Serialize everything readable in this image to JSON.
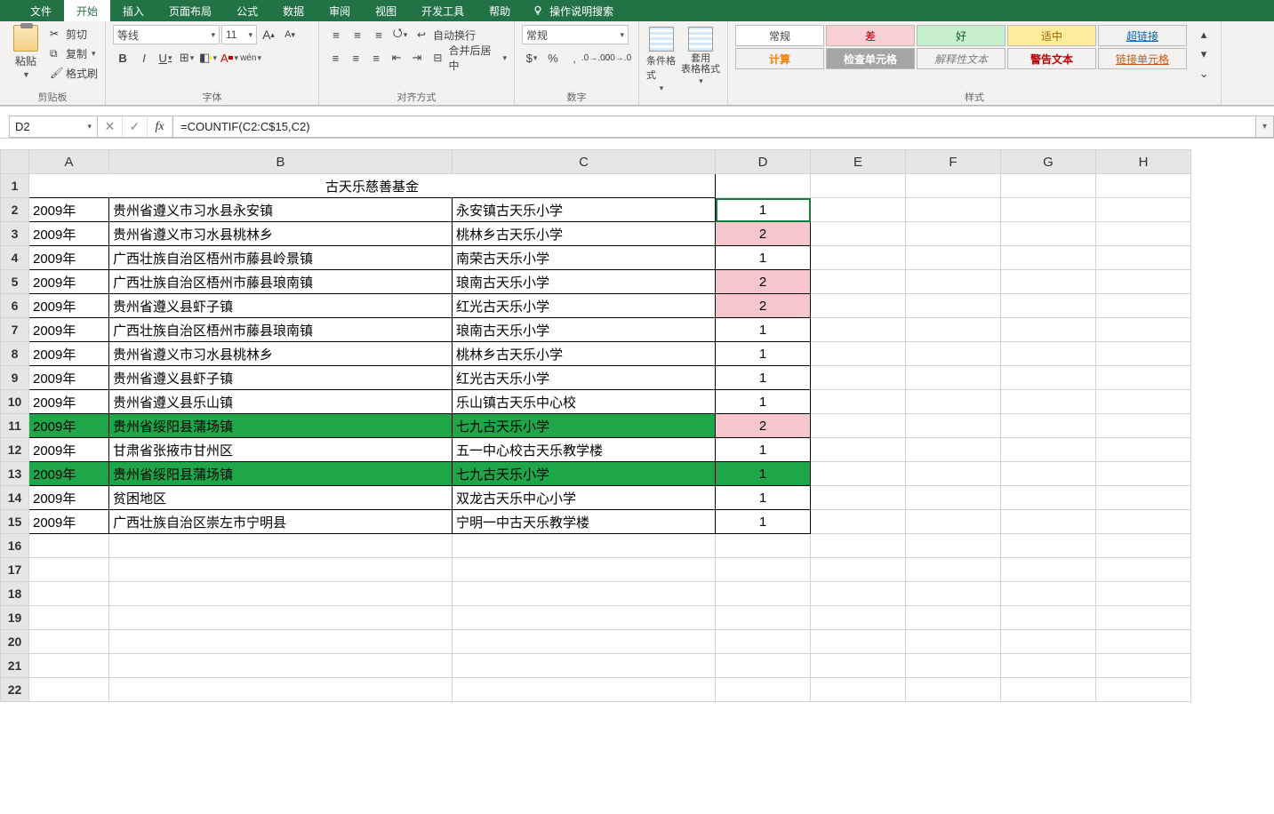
{
  "ribbon_tabs": [
    "文件",
    "开始",
    "插入",
    "页面布局",
    "公式",
    "数据",
    "审阅",
    "视图",
    "开发工具",
    "帮助"
  ],
  "ribbon_tabs_active_index": 1,
  "search_hint": "操作说明搜索",
  "clipboard": {
    "paste": "粘贴",
    "cut": "剪切",
    "copy": "复制",
    "format_painter": "格式刷",
    "group": "剪贴板"
  },
  "font": {
    "name": "等线",
    "size": "11",
    "group": "字体",
    "increase": "A",
    "decrease": "A"
  },
  "alignment": {
    "wrap": "自动换行",
    "merge": "合并后居中",
    "group": "对齐方式"
  },
  "number": {
    "format": "常规",
    "group": "数字"
  },
  "cond": {
    "cond": "条件格式",
    "table": "套用\n表格格式"
  },
  "style_cells": {
    "changgui": "常规",
    "cha": "差",
    "hao": "好",
    "shizhong": "适中",
    "jisuan": "计算",
    "jiancha": "检查单元格",
    "jieshi": "解释性文本",
    "jinggao": "警告文本",
    "chaolianjie": "超链接",
    "lianjie": "链接单元格",
    "group": "样式"
  },
  "name_box": "D2",
  "formula": "=COUNTIF(C2:C$15,C2)",
  "columns": [
    "A",
    "B",
    "C",
    "D",
    "E",
    "F",
    "G",
    "H"
  ],
  "title_cell": "古天乐慈善基金",
  "rows": [
    {
      "r": 2,
      "A": "2009年",
      "B": "贵州省遵义市习水县永安镇",
      "C": "永安镇古天乐小学",
      "D": "1"
    },
    {
      "r": 3,
      "A": "2009年",
      "B": "贵州省遵义市习水县桃林乡",
      "C": "桃林乡古天乐小学",
      "D": "2",
      "dPink": true
    },
    {
      "r": 4,
      "A": "2009年",
      "B": "广西壮族自治区梧州市藤县岭景镇",
      "C": "南荣古天乐小学",
      "D": "1"
    },
    {
      "r": 5,
      "A": "2009年",
      "B": "广西壮族自治区梧州市藤县琅南镇",
      "C": "琅南古天乐小学",
      "D": "2",
      "dPink": true
    },
    {
      "r": 6,
      "A": "2009年",
      "B": "贵州省遵义县虾子镇",
      "C": "红光古天乐小学",
      "D": "2",
      "dPink": true
    },
    {
      "r": 7,
      "A": "2009年",
      "B": "广西壮族自治区梧州市藤县琅南镇",
      "C": "琅南古天乐小学",
      "D": "1"
    },
    {
      "r": 8,
      "A": "2009年",
      "B": "贵州省遵义市习水县桃林乡",
      "C": "桃林乡古天乐小学",
      "D": "1"
    },
    {
      "r": 9,
      "A": "2009年",
      "B": "贵州省遵义县虾子镇",
      "C": "红光古天乐小学",
      "D": "1"
    },
    {
      "r": 10,
      "A": "2009年",
      "B": "贵州省遵义县乐山镇",
      "C": "乐山镇古天乐中心校",
      "D": "1"
    },
    {
      "r": 11,
      "A": "2009年",
      "B": "贵州省绥阳县蒲场镇",
      "C": "七九古天乐小学",
      "D": "2",
      "green": true,
      "dPink": true
    },
    {
      "r": 12,
      "A": "2009年",
      "B": "甘肃省张掖市甘州区",
      "C": "五一中心校古天乐教学楼",
      "D": "1"
    },
    {
      "r": 13,
      "A": "2009年",
      "B": "贵州省绥阳县蒲场镇",
      "C": "七九古天乐小学",
      "D": "1",
      "green": true
    },
    {
      "r": 14,
      "A": "2009年",
      "B": "贫困地区",
      "C": "双龙古天乐中心小学",
      "D": "1"
    },
    {
      "r": 15,
      "A": "2009年",
      "B": "广西壮族自治区崇左市宁明县",
      "C": "宁明一中古天乐教学楼",
      "D": "1"
    }
  ],
  "empty_rows": [
    16,
    17,
    18,
    19,
    20,
    21,
    22
  ]
}
